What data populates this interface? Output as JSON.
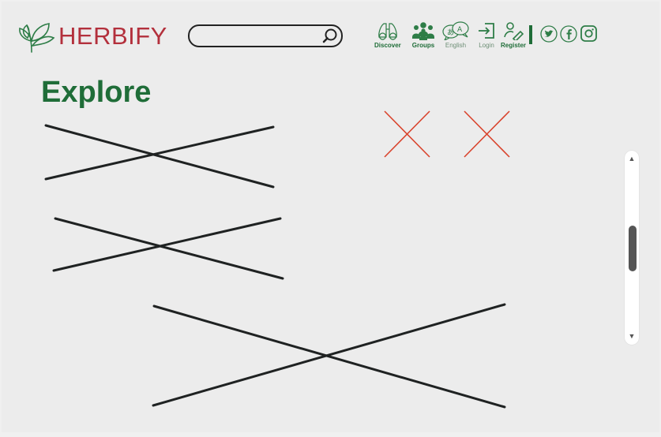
{
  "brand": {
    "name": "HERBIFY",
    "color": "#b3303c",
    "leaf_color": "#2e7d47"
  },
  "search": {
    "placeholder": "",
    "value": ""
  },
  "nav": {
    "discover": {
      "label": "Discover",
      "icon": "binoculars-icon"
    },
    "groups": {
      "label": "Groups",
      "icon": "people-icon"
    },
    "language": {
      "label": "English",
      "icon": "translate-icon"
    },
    "login": {
      "label": "Login",
      "icon": "login-icon"
    },
    "register": {
      "label": "Register",
      "icon": "register-icon"
    }
  },
  "social": [
    "twitter-icon",
    "facebook-icon",
    "instagram-icon"
  ],
  "main": {
    "title": "Explore"
  },
  "colors": {
    "accent": "#1f6d38",
    "error_x": "#d9432c",
    "placeholder_line": "#1f2222"
  }
}
